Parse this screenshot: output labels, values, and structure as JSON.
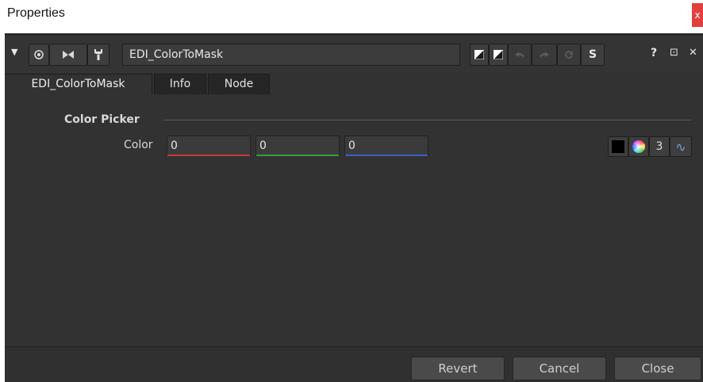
{
  "window": {
    "title": "Properties",
    "close_glyph": "x"
  },
  "toolbar": {
    "collapse_glyph": "▼",
    "node_name": "EDI_ColorToMask",
    "s_label": "S",
    "help_glyph": "?",
    "float_glyph": "⊡",
    "close_glyph": "✕"
  },
  "tabs": [
    {
      "label": "EDI_ColorToMask"
    },
    {
      "label": "Info"
    },
    {
      "label": "Node"
    }
  ],
  "section": {
    "title": "Color Picker"
  },
  "color_knob": {
    "label": "Color",
    "values": [
      "0",
      "0",
      "0"
    ],
    "channels_count": "3",
    "curve_glyph": "∿"
  },
  "footer": {
    "revert": "Revert",
    "cancel": "Cancel",
    "close": "Close"
  },
  "colors": {
    "panel_bg": "#323232",
    "red_channel": "#c23b3b",
    "green_channel": "#3a9a3a",
    "blue_channel": "#3b5fbf"
  }
}
